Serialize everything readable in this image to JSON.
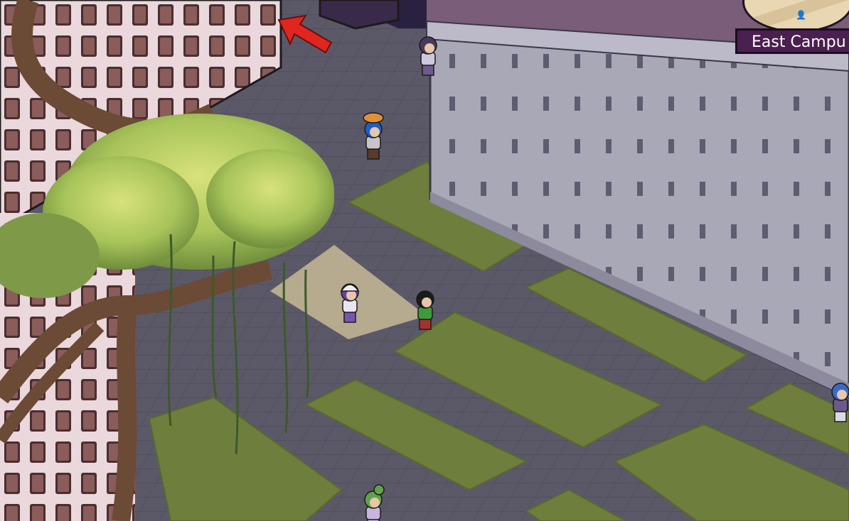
{
  "hud": {
    "location": "East Campu",
    "minimap": {
      "player_icon": "person-icon"
    }
  },
  "scene": {
    "guide_arrow": {
      "icon": "red-arrow-icon",
      "color": "#e0261e"
    },
    "avatars": [
      {
        "name": "avatar-blue-hair-with-cat",
        "hat": "cat-on-head",
        "hair": "#1e5fc4",
        "shirt": "#c8c4cc",
        "pants": "#5a3a2a"
      },
      {
        "name": "avatar-baseball-cap",
        "hat": "cap",
        "hair": "#6a3fa0",
        "shirt": "#e8e6f0",
        "pants": "#7a54b0"
      },
      {
        "name": "avatar-afro-green-shirt",
        "hat": "none",
        "hair": "#1a1a1a",
        "shirt": "#3f9a3a",
        "pants": "#a83030"
      },
      {
        "name": "avatar-blue-hair-right",
        "hat": "none",
        "hair": "#3c68c8",
        "shirt": "#6a5a8a",
        "pants": "#dcd8e4"
      },
      {
        "name": "avatar-green-hair-bottom",
        "hat": "bun",
        "hair": "#5fa34a",
        "shirt": "#c9b4e0",
        "pants": "#c9b4e0"
      },
      {
        "name": "avatar-top-partial",
        "hat": "none",
        "hair": "#4a3a5a",
        "shirt": "#cfc8dc",
        "pants": "#6e5a90"
      }
    ],
    "colors": {
      "pavement": "#5b5968",
      "grass": "#6e7e3c",
      "building_wall": "#a9a8b6",
      "roof": "#7a5d78",
      "highlight_tile": "#c7b896",
      "foliage": "#a8c45a",
      "trunk": "#6b4a36"
    }
  }
}
